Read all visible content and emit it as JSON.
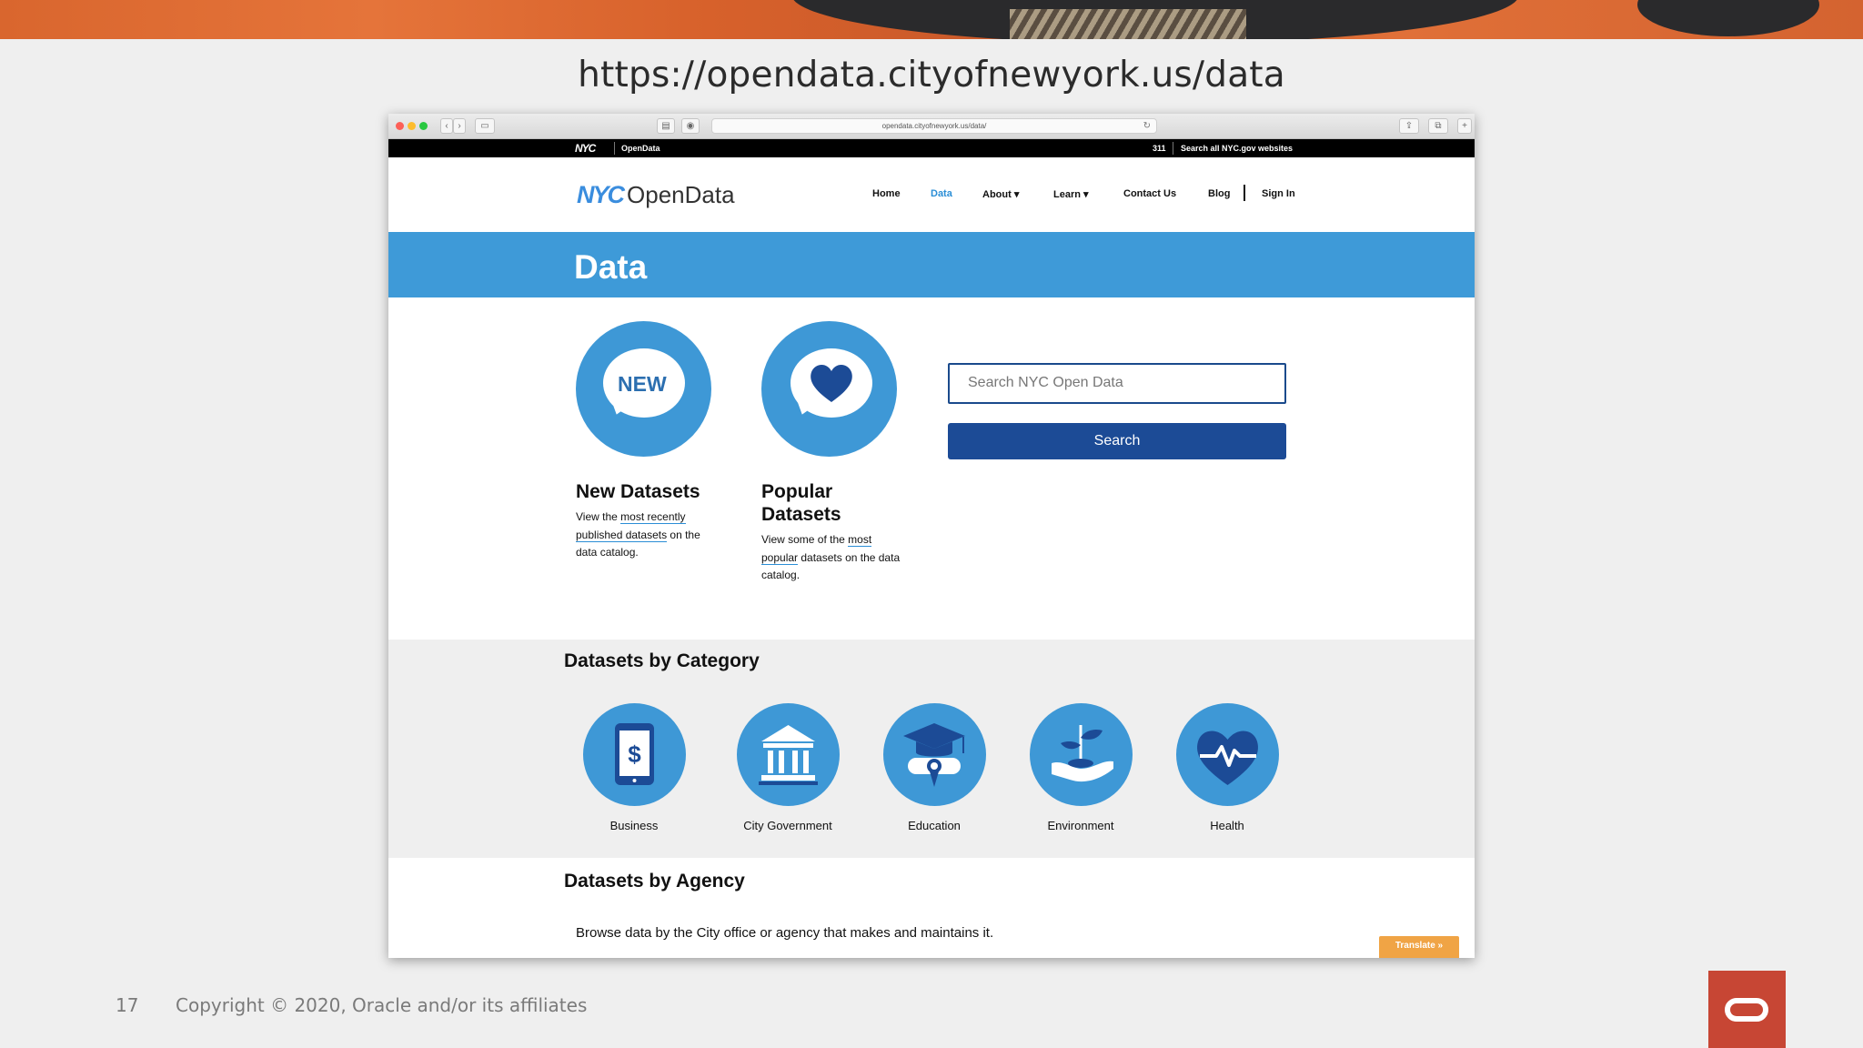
{
  "slide": {
    "url_title": "https://opendata.cityofnewyork.us/data",
    "page_number": "17",
    "copyright": "Copyright © 2020, Oracle and/or its affiliates"
  },
  "browser": {
    "address": "opendata.cityofnewyork.us/data/"
  },
  "site": {
    "topbar": {
      "logo": "NYC",
      "brand": "OpenData",
      "n311": "311",
      "search_all": "Search all NYC.gov websites"
    },
    "logo_nyc": "NYC",
    "logo_text": "OpenData",
    "nav": {
      "home": "Home",
      "data": "Data",
      "about": "About ▾",
      "learn": "Learn ▾",
      "contact": "Contact Us",
      "blog": "Blog",
      "signin": "Sign In"
    },
    "hero_title": "Data",
    "new_badge": "NEW",
    "new_datasets": {
      "title": "New Datasets",
      "desc_pre": "View the ",
      "desc_link1": "most recently",
      "desc_link2": "published datasets",
      "desc_post": " on the",
      "desc_tail": "data catalog."
    },
    "popular_datasets": {
      "title_line1": "Popular",
      "title_line2": "Datasets",
      "desc_pre": "View some of the ",
      "desc_link1": "most",
      "desc_link2": "popular",
      "desc_post": " datasets on the data",
      "desc_tail": "catalog."
    },
    "search": {
      "placeholder": "Search NYC Open Data",
      "button": "Search"
    },
    "category_section_title": "Datasets by Category",
    "categories": [
      {
        "label": "Business",
        "icon": "business-phone-dollar-icon"
      },
      {
        "label": "City Government",
        "icon": "city-hall-icon"
      },
      {
        "label": "Education",
        "icon": "graduation-cap-icon"
      },
      {
        "label": "Environment",
        "icon": "sprout-hand-icon"
      },
      {
        "label": "Health",
        "icon": "heart-pulse-icon"
      }
    ],
    "agency_section_title": "Datasets by Agency",
    "agency_desc": "Browse data by the City office or agency that makes and maintains it.",
    "translate": "Translate »"
  },
  "colors": {
    "hero_blue": "#3e9ad8",
    "search_blue": "#1c4b96",
    "oracle_red": "#c74634",
    "translate_orange": "#f0a445"
  }
}
